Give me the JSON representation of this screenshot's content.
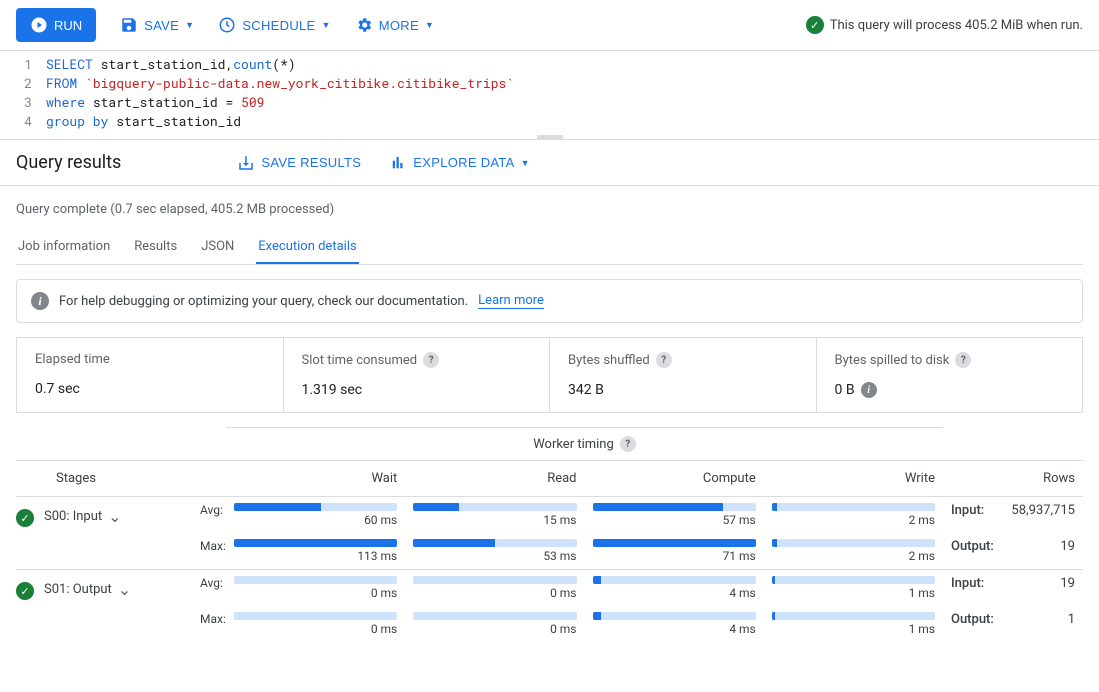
{
  "toolbar": {
    "run_label": "RUN",
    "save_label": "SAVE",
    "schedule_label": "SCHEDULE",
    "more_label": "MORE"
  },
  "status": "This query will process 405.2 MiB when run.",
  "editor": {
    "lines": [
      {
        "n": "1",
        "pre": "",
        "kw": "SELECT",
        "mid": " start_station_id,",
        "fn": "count",
        "post": "(*)"
      },
      {
        "n": "2",
        "pre": "",
        "kw": "FROM",
        "mid": " ",
        "str": "`bigquery-public-data.new_york_citibike.citibike_trips`"
      },
      {
        "n": "3",
        "pre": "",
        "kw": "where",
        "mid": " start_station_id = ",
        "num": "509"
      },
      {
        "n": "4",
        "pre": "",
        "kw": "group by",
        "mid": " start_station_id"
      }
    ]
  },
  "results": {
    "title": "Query results",
    "save_results": "SAVE RESULTS",
    "explore_data": "EXPLORE DATA"
  },
  "complete_text": "Query complete (0.7 sec elapsed, 405.2 MB processed)",
  "tabs": [
    "Job information",
    "Results",
    "JSON",
    "Execution details"
  ],
  "info_banner": {
    "text": "For help debugging or optimizing your query, check our documentation.",
    "link": "Learn more"
  },
  "stats": [
    {
      "label": "Elapsed time",
      "value": "0.7 sec",
      "help": false,
      "value_info": false
    },
    {
      "label": "Slot time consumed",
      "value": "1.319 sec",
      "help": true,
      "value_info": false
    },
    {
      "label": "Bytes shuffled",
      "value": "342 B",
      "help": true,
      "value_info": false
    },
    {
      "label": "Bytes spilled to disk",
      "value": "0 B",
      "help": true,
      "value_info": true
    }
  ],
  "timing": {
    "header": "Worker timing",
    "cols": {
      "stages": "Stages",
      "wait": "Wait",
      "read": "Read",
      "compute": "Compute",
      "write": "Write",
      "rows": "Rows"
    },
    "labels": {
      "avg": "Avg:",
      "max": "Max:",
      "input": "Input:",
      "output": "Output:"
    },
    "stages": [
      {
        "name": "S00: Input",
        "avg": {
          "wait": {
            "v": "60 ms",
            "p": 53
          },
          "read": {
            "v": "15 ms",
            "p": 28
          },
          "compute": {
            "v": "57 ms",
            "p": 80
          },
          "write": {
            "v": "2 ms",
            "p": 3
          }
        },
        "max": {
          "wait": {
            "v": "113 ms",
            "p": 100
          },
          "read": {
            "v": "53 ms",
            "p": 50
          },
          "compute": {
            "v": "71 ms",
            "p": 100
          },
          "write": {
            "v": "2 ms",
            "p": 3
          }
        },
        "input": "58,937,715",
        "output": "19"
      },
      {
        "name": "S01: Output",
        "avg": {
          "wait": {
            "v": "0 ms",
            "p": 0
          },
          "read": {
            "v": "0 ms",
            "p": 0
          },
          "compute": {
            "v": "4 ms",
            "p": 5
          },
          "write": {
            "v": "1 ms",
            "p": 2
          }
        },
        "max": {
          "wait": {
            "v": "0 ms",
            "p": 0
          },
          "read": {
            "v": "0 ms",
            "p": 0
          },
          "compute": {
            "v": "4 ms",
            "p": 5
          },
          "write": {
            "v": "1 ms",
            "p": 2
          }
        },
        "input": "19",
        "output": "1"
      }
    ]
  }
}
